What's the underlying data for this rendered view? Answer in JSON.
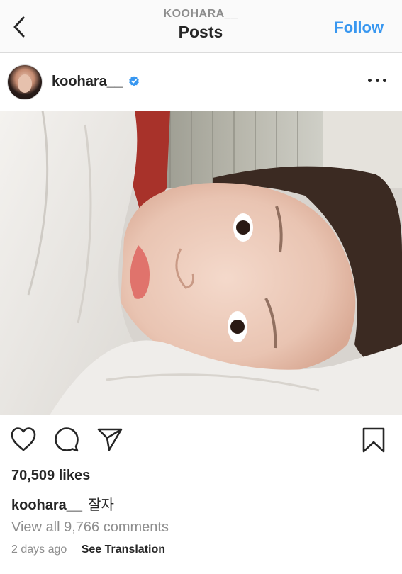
{
  "header": {
    "username": "KOOHARA__",
    "title": "Posts",
    "follow_label": "Follow"
  },
  "post": {
    "author": "koohara__",
    "verified": true,
    "likes": "70,509 likes",
    "caption_user": "koohara__",
    "caption_text": "잘자",
    "comments_link": "View all 9,766 comments",
    "timestamp": "2 days ago",
    "translate_label": "See Translation"
  },
  "icons": {
    "back": "chevron-left-icon",
    "verified": "verified-badge-icon",
    "more": "more-options-icon",
    "like": "heart-icon",
    "comment": "comment-icon",
    "share": "send-icon",
    "save": "bookmark-icon"
  },
  "colors": {
    "accent": "#3897f0",
    "text": "#262626",
    "muted": "#8e8e8e"
  }
}
